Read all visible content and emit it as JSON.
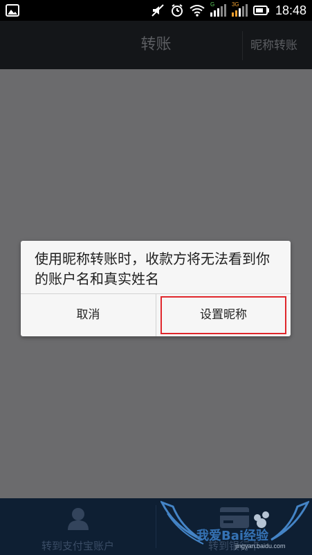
{
  "status_bar": {
    "time": "18:48",
    "sim1_label": "G",
    "sim2_label": "3G",
    "icons": [
      "image-notification-icon",
      "mute-icon",
      "alarm-icon",
      "wifi-icon",
      "signal-icon",
      "battery-icon"
    ]
  },
  "header": {
    "title": "转账",
    "nickname_transfer_label": "昵称转账"
  },
  "dialog": {
    "message": "使用昵称转账时，收款方将无法看到你的账户名和真实姓名",
    "cancel_label": "取消",
    "set_nickname_label": "设置昵称"
  },
  "bottom_tabs": [
    {
      "label": "转到支付宝账户",
      "icon": "person-icon"
    },
    {
      "label": "转到银行卡",
      "icon": "bank-card-icon"
    }
  ],
  "watermark": {
    "text": "我爱Bai经验",
    "url": "jingyan.baidu.com"
  },
  "colors": {
    "highlight": "#e0262b",
    "overlay": "#6b6b6d",
    "header": "#141619",
    "bottom_bar": "#0e1f33"
  }
}
